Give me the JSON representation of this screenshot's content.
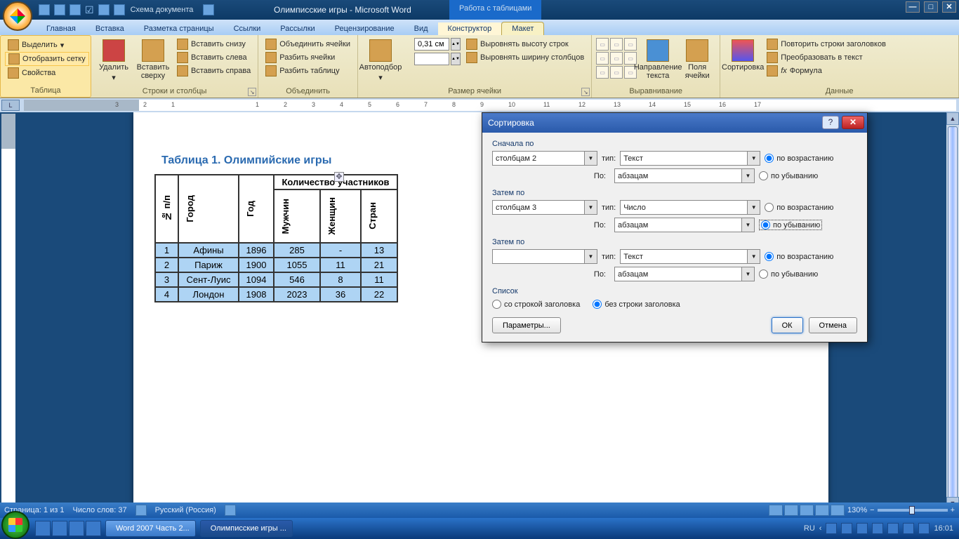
{
  "titlebar": {
    "qat_schema_label": "Схема документа",
    "doc_title": "Олимписские игры - Microsoft Word",
    "context_group": "Работа с таблицами"
  },
  "ribbon": {
    "tabs": [
      "Главная",
      "Вставка",
      "Разметка страницы",
      "Ссылки",
      "Рассылки",
      "Рецензирование",
      "Вид",
      "Конструктор",
      "Макет"
    ],
    "active_tab_index": 8,
    "table_group": {
      "label": "Таблица",
      "select": "Выделить",
      "show_grid": "Отобразить сетку",
      "props": "Свойства"
    },
    "rows_cols_group": {
      "label": "Строки и столбцы",
      "delete": "Удалить",
      "insert_top": "Вставить сверху",
      "insert_below": "Вставить снизу",
      "insert_left": "Вставить слева",
      "insert_right": "Вставить справа"
    },
    "merge_group": {
      "label": "Объединить",
      "merge_cells": "Объединить ячейки",
      "split_cells": "Разбить ячейки",
      "split_table": "Разбить таблицу"
    },
    "autofit": "Автоподбор",
    "cell_size_group": {
      "label": "Размер ячейки",
      "height_value": "0,31 см",
      "dist_rows": "Выровнять высоту строк",
      "dist_cols": "Выровнять ширину столбцов"
    },
    "alignment_group": {
      "label": "Выравнивание",
      "text_dir": "Направление текста",
      "margins": "Поля ячейки"
    },
    "data_group": {
      "label": "Данные",
      "sort": "Сортировка",
      "repeat_header": "Повторить строки заголовков",
      "to_text": "Преобразовать в текст",
      "formula": "Формула"
    }
  },
  "document": {
    "table_title": "Таблица 1. Олимпийские игры",
    "headers": {
      "num": "№ п/п",
      "city": "Город",
      "year": "Год",
      "count": "Количество участников",
      "men": "Мужчин",
      "women": "Женщин",
      "countries": "Стран"
    },
    "rows": [
      {
        "n": "1",
        "city": "Афины",
        "year": "1896",
        "men": "285",
        "women": "-",
        "countries": "13"
      },
      {
        "n": "2",
        "city": "Париж",
        "year": "1900",
        "men": "1055",
        "women": "11",
        "countries": "21"
      },
      {
        "n": "3",
        "city": "Сент-Луис",
        "year": "1094",
        "men": "546",
        "women": "8",
        "countries": "11"
      },
      {
        "n": "4",
        "city": "Лондон",
        "year": "1908",
        "men": "2023",
        "women": "36",
        "countries": "22"
      }
    ]
  },
  "dialog": {
    "title": "Сортировка",
    "first_by": "Сначала по",
    "then_by": "Затем по",
    "type_label": "тип:",
    "po_label": "По:",
    "asc": "по возрастанию",
    "desc": "по убыванию",
    "level1_col": "столбцам 2",
    "level1_type": "Текст",
    "level1_po": "абзацам",
    "level2_col": "столбцам 3",
    "level2_type": "Число",
    "level2_po": "абзацам",
    "level3_col": "",
    "level3_type": "Текст",
    "level3_po": "абзацам",
    "list_label": "Список",
    "with_header": "со строкой заголовка",
    "without_header": "без строки заголовка",
    "params_btn": "Параметры...",
    "ok_btn": "ОК",
    "cancel_btn": "Отмена"
  },
  "statusbar": {
    "page": "Страница: 1 из 1",
    "words": "Число слов: 37",
    "lang": "Русский (Россия)",
    "zoom": "130%"
  },
  "taskbar": {
    "task1": "Word 2007 Часть 2...",
    "task2": "Олимписские игры ...",
    "lang": "RU",
    "clock": "16:01"
  }
}
